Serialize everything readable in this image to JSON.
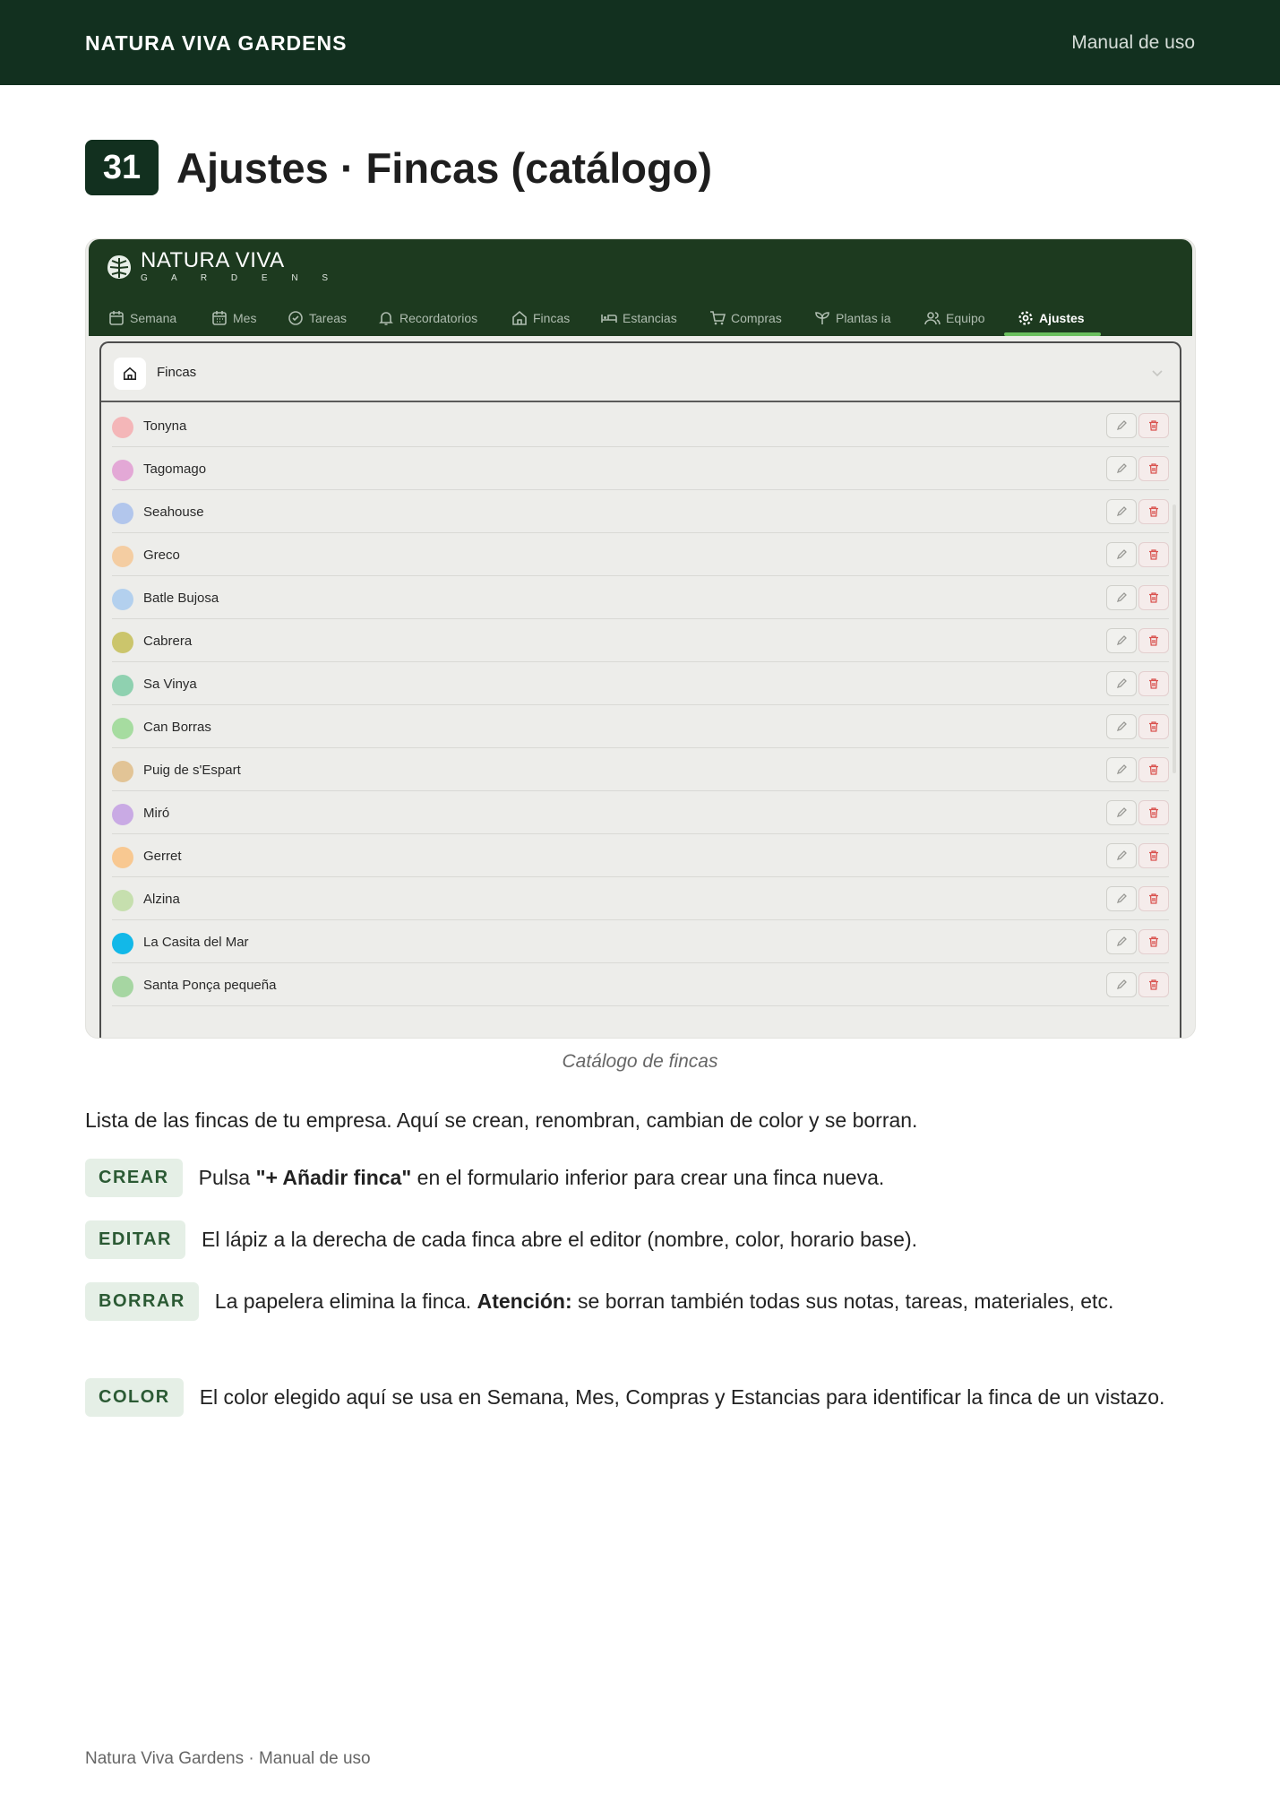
{
  "topbar": {
    "brand": "NATURA VIVA GARDENS",
    "manual": "Manual de uso"
  },
  "section": {
    "number": "31",
    "title": "Ajustes · Fincas (catálogo)"
  },
  "screenshot": {
    "logo": {
      "line1": "NATURA VIVA",
      "line2": "G A R D E N S",
      "icon": "monstera-leaf-icon"
    },
    "nav": [
      {
        "label": "Semana",
        "icon": "calendar-icon"
      },
      {
        "label": "Mes",
        "icon": "calendar-grid-icon"
      },
      {
        "label": "Tareas",
        "icon": "check-circle-icon"
      },
      {
        "label": "Recordatorios",
        "icon": "bell-icon"
      },
      {
        "label": "Fincas",
        "icon": "home-icon"
      },
      {
        "label": "Estancias",
        "icon": "bed-icon"
      },
      {
        "label": "Compras",
        "icon": "cart-icon"
      },
      {
        "label": "Plantas ia",
        "icon": "plant-icon"
      },
      {
        "label": "Equipo",
        "icon": "users-icon"
      },
      {
        "label": "Ajustes",
        "icon": "gear-icon",
        "active": true
      }
    ],
    "panel": {
      "title": "Fincas",
      "icon": "home-icon"
    },
    "fincas": [
      {
        "name": "Tonyna",
        "color": "#f4b6b8"
      },
      {
        "name": "Tagomago",
        "color": "#e3a8d6"
      },
      {
        "name": "Seahouse",
        "color": "#b2c6ec"
      },
      {
        "name": "Greco",
        "color": "#f4cda2"
      },
      {
        "name": "Batle Bujosa",
        "color": "#b3d0ee"
      },
      {
        "name": "Cabrera",
        "color": "#cbc56c"
      },
      {
        "name": "Sa Vinya",
        "color": "#8fd1b0"
      },
      {
        "name": "Can Borras",
        "color": "#a6dca0"
      },
      {
        "name": "Puig de s'Espart",
        "color": "#e2c496"
      },
      {
        "name": "Miró",
        "color": "#c9aae4"
      },
      {
        "name": "Gerret",
        "color": "#f8c891"
      },
      {
        "name": "Alzina",
        "color": "#c6dfae"
      },
      {
        "name": "La Casita del Mar",
        "color": "#12b8e8"
      },
      {
        "name": "Santa Ponça pequeña",
        "color": "#a6d6a2"
      }
    ],
    "colors": {
      "header_bg": "#1d3a1f",
      "active_underline": "#6abf5e",
      "delete_red": "#d9534f"
    }
  },
  "caption": "Catálogo de fincas",
  "intro": "Lista de las fincas de tu empresa. Aquí se crean, renombran, cambian de color y se borran.",
  "items": {
    "crear": {
      "tag": "CREAR",
      "before": "Pulsa ",
      "bold": "\"+ Añadir finca\"",
      "after": " en el formulario inferior para crear una finca nueva."
    },
    "editar": {
      "tag": "EDITAR",
      "text": "El lápiz a la derecha de cada finca abre el editor (nombre, color, horario base)."
    },
    "borrar": {
      "tag": "BORRAR",
      "before": "La papelera elimina la finca. ",
      "bold": "Atención:",
      "after": " se borran también todas sus notas, tareas, materiales, etc."
    },
    "color": {
      "tag": "COLOR",
      "text": "El color elegido aquí se usa en Semana, Mes, Compras y Estancias para identificar la finca de un vistazo."
    }
  },
  "footer": "Natura Viva Gardens · Manual de uso"
}
